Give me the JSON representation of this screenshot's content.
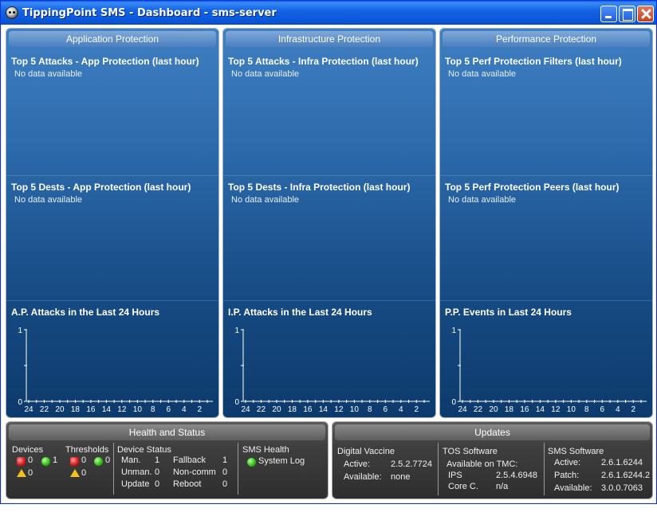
{
  "window": {
    "title": "TippingPoint SMS - Dashboard - sms-server"
  },
  "panels": [
    {
      "header": "Application Protection",
      "sections": [
        {
          "title": "Top 5 Attacks - App Protection (last hour)",
          "message": "No data available"
        },
        {
          "title": "Top 5 Dests - App Protection (last hour)",
          "message": "No data available"
        }
      ],
      "chart_title": "A.P. Attacks in the Last 24 Hours"
    },
    {
      "header": "Infrastructure Protection",
      "sections": [
        {
          "title": "Top 5 Attacks - Infra Protection (last hour)",
          "message": "No data available"
        },
        {
          "title": "Top 5 Dests - Infra Protection (last hour)",
          "message": "No data available"
        }
      ],
      "chart_title": "I.P. Attacks in the Last 24 Hours"
    },
    {
      "header": "Performance Protection",
      "sections": [
        {
          "title": "Top 5 Perf Protection Filters (last hour)",
          "message": "No data available"
        },
        {
          "title": "Top 5 Perf Protection Peers (last hour)",
          "message": "No data available"
        }
      ],
      "chart_title": "P.P. Events in Last 24 Hours"
    }
  ],
  "chart_data": [
    {
      "type": "line",
      "title": "A.P. Attacks in the Last 24 Hours",
      "x": [
        24,
        22,
        20,
        18,
        16,
        14,
        12,
        10,
        8,
        6,
        4,
        2
      ],
      "series": [],
      "yticks": [
        "1",
        "0"
      ],
      "ylim": [
        0,
        1
      ]
    },
    {
      "type": "line",
      "title": "I.P. Attacks in the Last 24 Hours",
      "x": [
        24,
        22,
        20,
        18,
        16,
        14,
        12,
        10,
        8,
        6,
        4,
        2
      ],
      "series": [],
      "yticks": [
        "1",
        "0"
      ],
      "ylim": [
        0,
        1
      ]
    },
    {
      "type": "line",
      "title": "P.P. Events in Last 24 Hours",
      "x": [
        24,
        22,
        20,
        18,
        16,
        14,
        12,
        10,
        8,
        6,
        4,
        2
      ],
      "series": [],
      "yticks": [
        "1",
        "0"
      ],
      "ylim": [
        0,
        1
      ]
    }
  ],
  "health": {
    "header": "Health and Status",
    "devices": {
      "label": "Devices",
      "critical": "0",
      "ok": "1",
      "warning": "0"
    },
    "thresholds": {
      "label": "Thresholds",
      "critical": "0",
      "ok": "0",
      "warning": "0"
    },
    "device_status": {
      "label": "Device Status",
      "rows": [
        {
          "label": "Man.",
          "value": "1",
          "label2": "Fallback",
          "value2": "1"
        },
        {
          "label": "Unman.",
          "value": "0",
          "label2": "Non-comm",
          "value2": "0"
        },
        {
          "label": "Update",
          "value": "0",
          "label2": "Reboot",
          "value2": "0"
        }
      ]
    },
    "sms_health": {
      "label": "SMS Health",
      "item": "System Log"
    },
    "colors": {
      "ok": "#34c018",
      "critical": "#d01818",
      "warning": "#f2c21b"
    }
  },
  "updates": {
    "header": "Updates",
    "digital_vaccine": {
      "label": "Digital Vaccine",
      "active_label": "Active:",
      "active": "2.5.2.7724",
      "available_label": "Available:",
      "available": "none"
    },
    "tos": {
      "label": "TOS Software",
      "sub": "Available on TMC:",
      "ips_label": "IPS",
      "ips": "2.5.4.6948",
      "core_label": "Core C.",
      "core": "n/a"
    },
    "sms": {
      "label": "SMS Software",
      "active_label": "Active:",
      "active": "2.6.1.6244",
      "patch_label": "Patch:",
      "patch": "2.6.1.6244.2",
      "available_label": "Available:",
      "available": "3.0.0.7063"
    }
  }
}
